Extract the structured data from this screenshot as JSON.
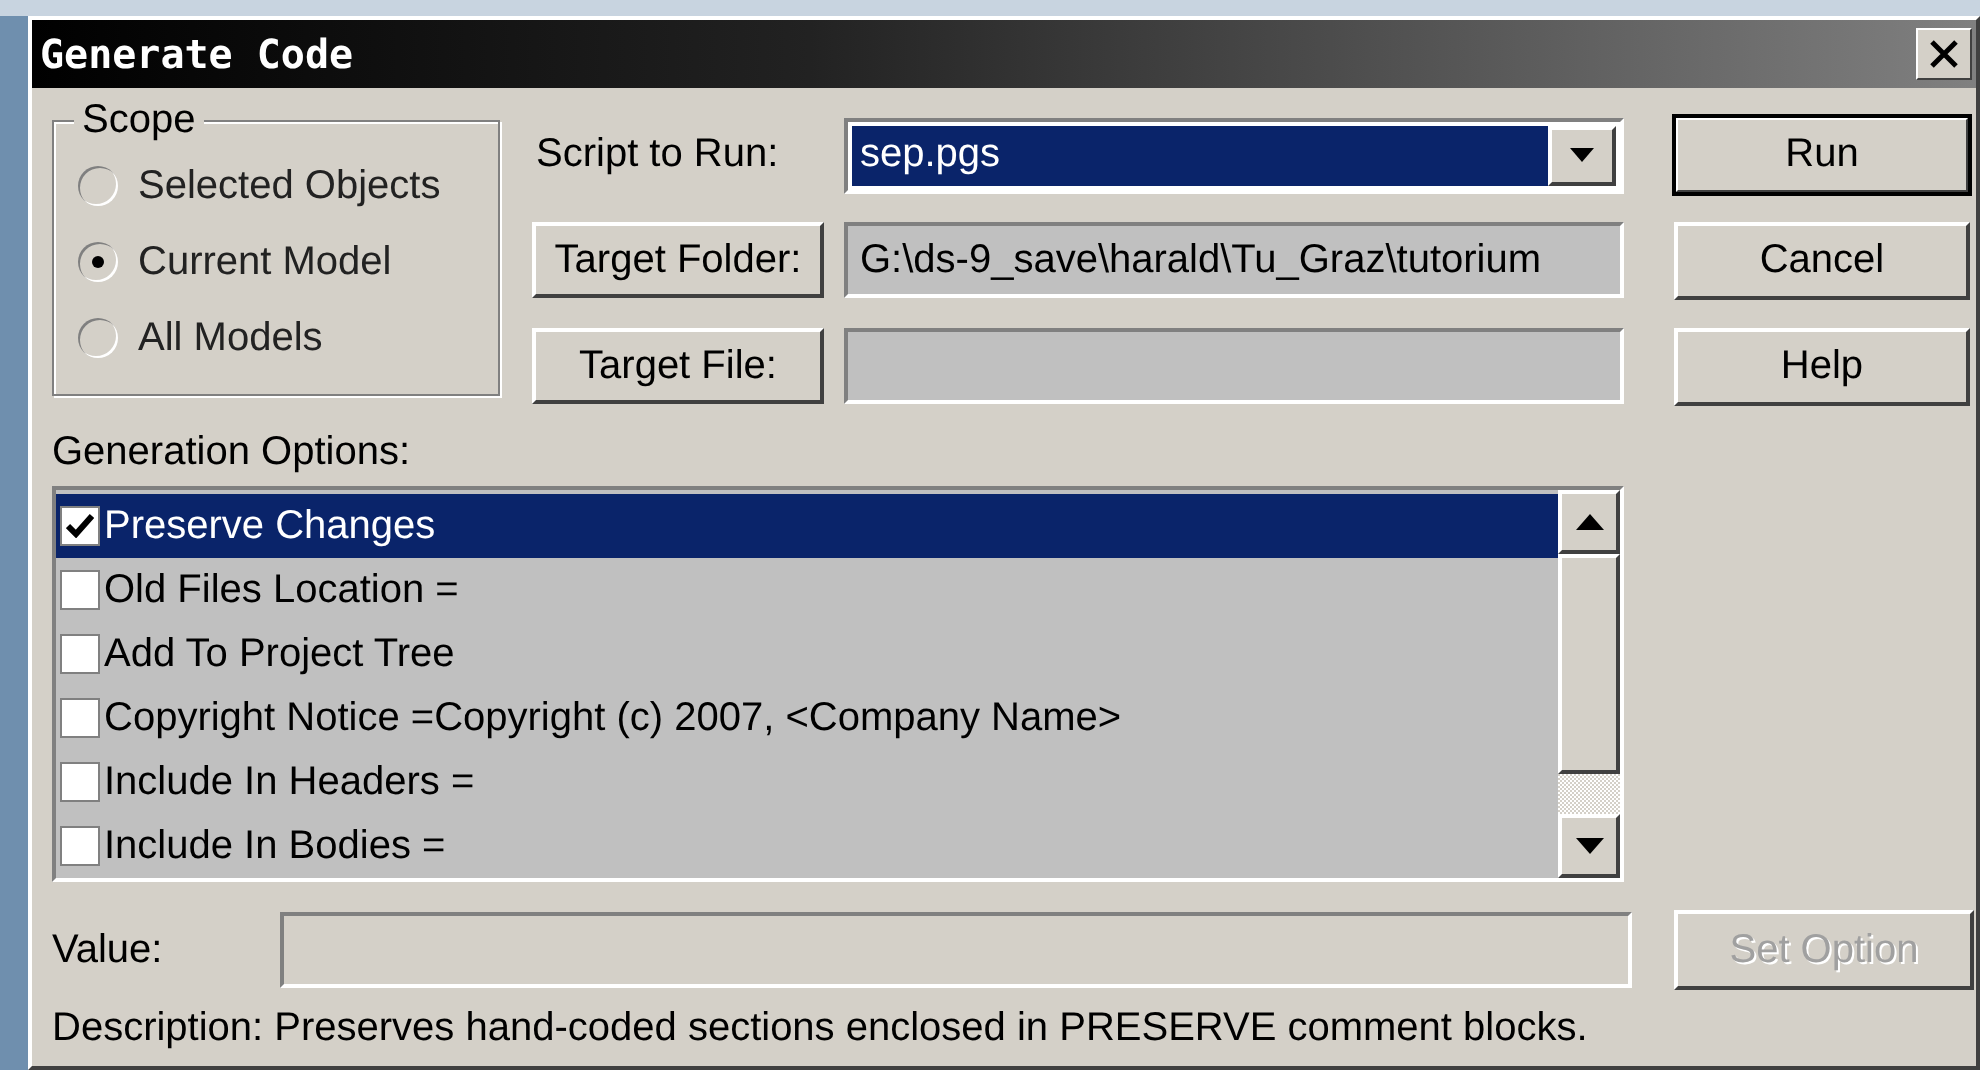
{
  "window": {
    "title": "Generate Code"
  },
  "scope": {
    "title": "Scope",
    "options": [
      {
        "label": "Selected Objects",
        "selected": false
      },
      {
        "label": "Current Model",
        "selected": true
      },
      {
        "label": "All Models",
        "selected": false
      }
    ]
  },
  "script": {
    "label": "Script to Run:",
    "value": "sep.pgs",
    "selected": true
  },
  "target_folder": {
    "button": "Target Folder:",
    "value": "G:\\ds-9_save\\harald\\Tu_Graz\\tutorium"
  },
  "target_file": {
    "button": "Target File:"
  },
  "buttons": [
    {
      "label": "Run",
      "default": true
    },
    {
      "label": "Cancel",
      "default": false
    },
    {
      "label": "Help",
      "default": false
    }
  ],
  "generation_options": {
    "label": "Generation Options:",
    "items": [
      {
        "label": "Preserve Changes",
        "checked": true,
        "selected": true
      },
      {
        "label": "Old Files Location =",
        "checked": false,
        "selected": false
      },
      {
        "label": "Add To Project Tree",
        "checked": false,
        "selected": false
      },
      {
        "label": "Copyright Notice =Copyright (c) 2007, <Company Name>",
        "checked": false,
        "selected": false
      },
      {
        "label": "Include In Headers =",
        "checked": false,
        "selected": false
      },
      {
        "label": "Include In Bodies =",
        "checked": false,
        "selected": false
      }
    ]
  },
  "value": {
    "label": "Value:"
  },
  "set_option": {
    "label": "Set Option",
    "disabled": true
  },
  "description": "Description: Preserves hand-coded sections enclosed in PRESERVE comment blocks."
}
